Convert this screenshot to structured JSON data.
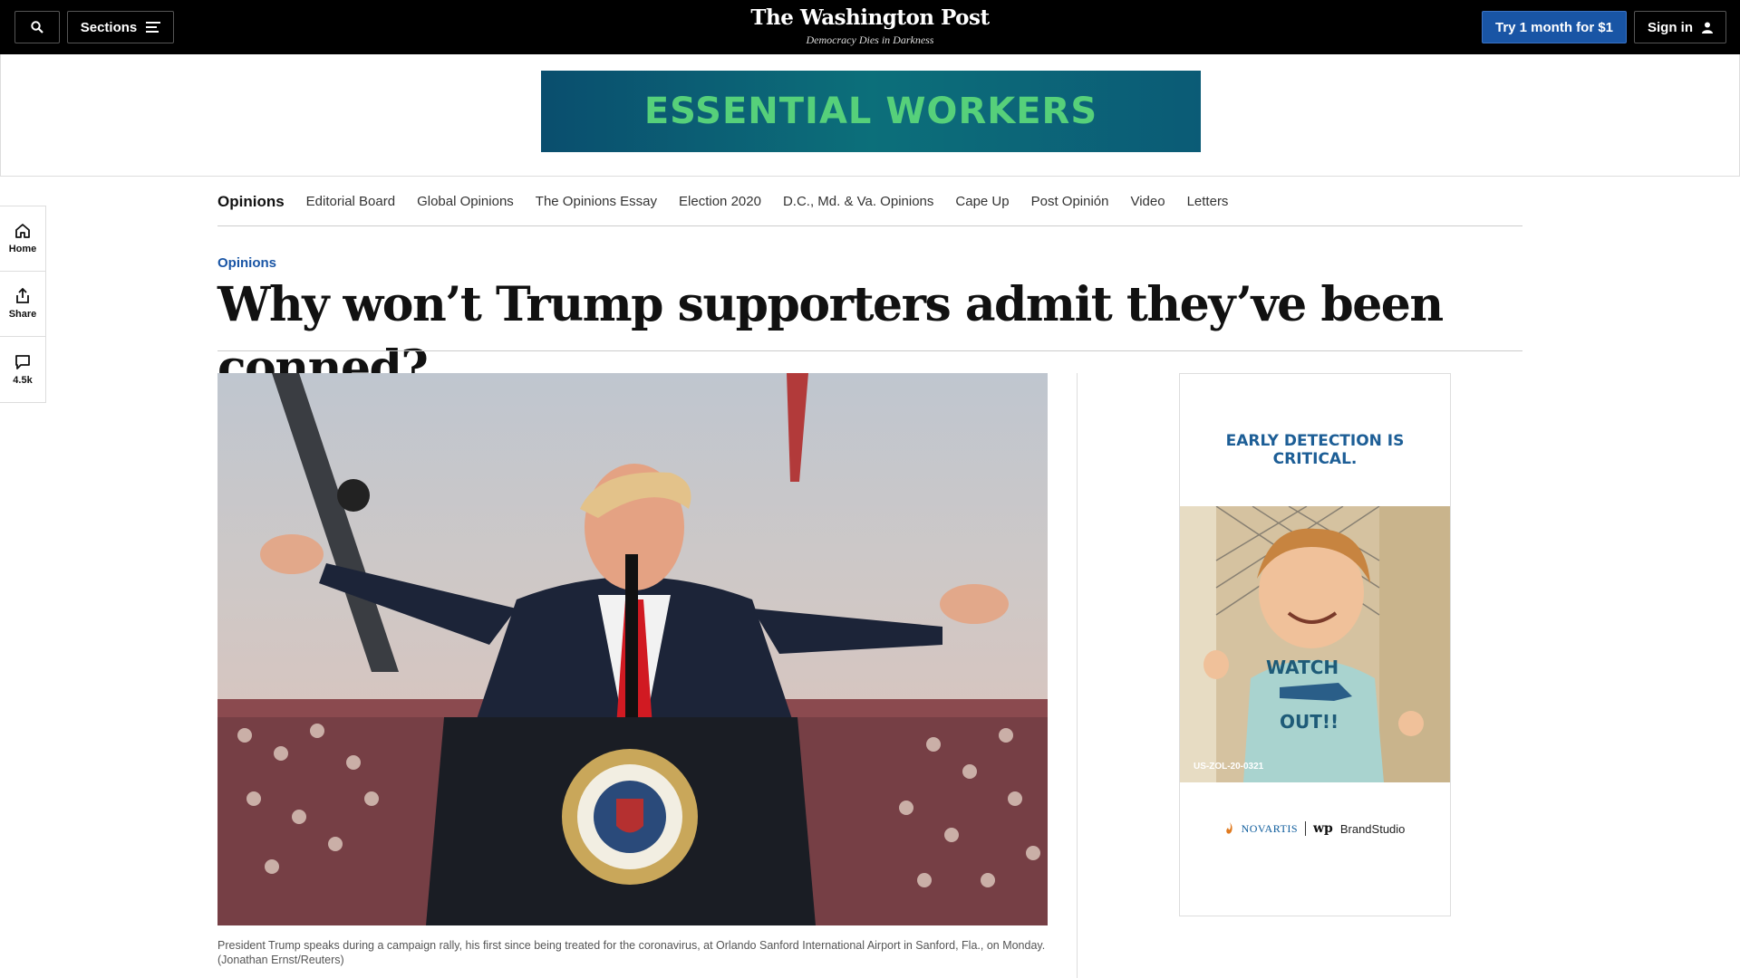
{
  "topbar": {
    "sections_label": "Sections",
    "masthead_title": "The Washington Post",
    "masthead_tagline": "Democracy Dies in Darkness",
    "subscribe_label": "Try 1 month for $1",
    "signin_label": "Sign in"
  },
  "ad_banner": {
    "text": "ESSENTIAL WORKERS"
  },
  "rail": {
    "items": [
      {
        "label": "Home",
        "icon": "home-icon"
      },
      {
        "label": "Share",
        "icon": "share-icon"
      },
      {
        "label": "4.5k",
        "icon": "comment-icon"
      }
    ]
  },
  "nav": {
    "heading": "Opinions",
    "links": [
      "Editorial Board",
      "Global Opinions",
      "The Opinions Essay",
      "Election 2020",
      "D.C., Md. & Va. Opinions",
      "Cape Up",
      "Post Opinión",
      "Video",
      "Letters"
    ]
  },
  "article": {
    "kicker": "Opinions",
    "headline": "Why won’t Trump supporters admit they’ve been conned?",
    "caption": "President Trump speaks during a campaign rally, his first since being treated for the coronavirus, at Orlando Sanford International Airport in Sanford, Fla., on Monday. (Jonathan Ernst/Reuters)"
  },
  "side_ad": {
    "headline_line1": "EARLY DETECTION IS",
    "headline_line2": "CRITICAL.",
    "code": "US-ZOL-20-0321",
    "brand1": "NOVARTIS",
    "brand2_logo": "wp",
    "brand2": "BrandStudio",
    "shirt_line1": "WATCH",
    "shirt_line2": "OUT!!"
  },
  "colors": {
    "topbar": "#000000",
    "accent": "#1955a5",
    "ad_green": "#56d07a"
  }
}
